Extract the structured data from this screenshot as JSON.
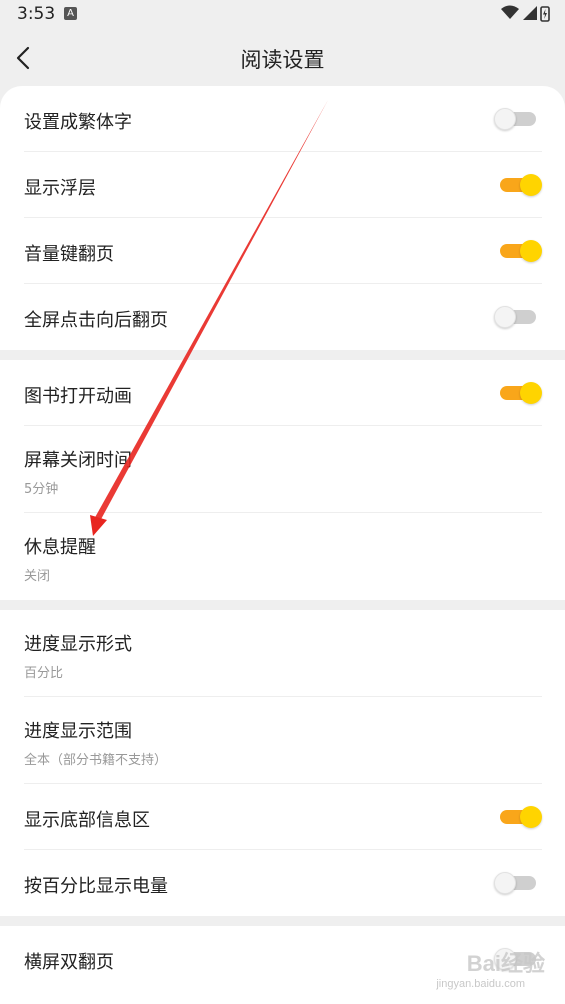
{
  "status_bar": {
    "time": "3:53",
    "badge": "A"
  },
  "header": {
    "title": "阅读设置"
  },
  "groups": [
    {
      "items": [
        {
          "label": "设置成繁体字",
          "toggle": "off"
        },
        {
          "label": "显示浮层",
          "toggle": "on"
        },
        {
          "label": "音量键翻页",
          "toggle": "on"
        },
        {
          "label": "全屏点击向后翻页",
          "toggle": "off"
        }
      ]
    },
    {
      "items": [
        {
          "label": "图书打开动画",
          "toggle": "on"
        },
        {
          "label": "屏幕关闭时间",
          "value": "5分钟"
        },
        {
          "label": "休息提醒",
          "value": "关闭"
        }
      ]
    },
    {
      "items": [
        {
          "label": "进度显示形式",
          "value": "百分比"
        },
        {
          "label": "进度显示范围",
          "value": "全本（部分书籍不支持）"
        },
        {
          "label": "显示底部信息区",
          "toggle": "on"
        },
        {
          "label": "按百分比显示电量",
          "toggle": "off"
        }
      ]
    },
    {
      "items": [
        {
          "label": "横屏双翻页",
          "toggle": "off"
        }
      ]
    }
  ],
  "watermark": {
    "text": "Bai经验",
    "url": "jingyan.baidu.com"
  },
  "colors": {
    "toggle_on_track": "#f9a61a",
    "toggle_on_knob": "#ffd400",
    "toggle_off_track": "#cfcfcf",
    "annotation_arrow": "#e8251f"
  }
}
